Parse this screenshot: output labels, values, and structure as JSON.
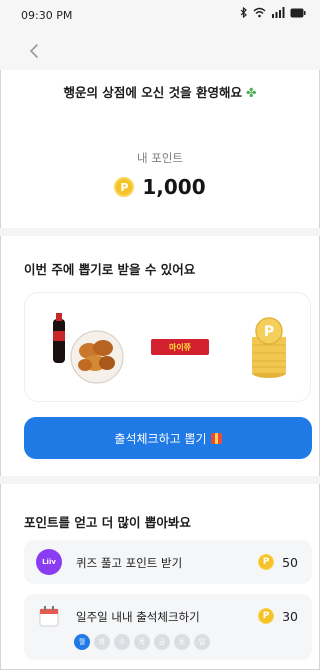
{
  "status_bar": {
    "time": "09:30 PM"
  },
  "header": {
    "back_icon": "chevron-left-icon"
  },
  "welcome": {
    "text": "행운의 상점에 오신 것을 환영해요",
    "icon": "clover-icon"
  },
  "points": {
    "label": "내 포인트",
    "value": "1,000",
    "coin_letter": "P"
  },
  "prizes": {
    "title": "이번 주에 뽑기로 받을 수 있어요",
    "items": [
      "cola-and-chicken",
      "snack-bar",
      "coin-stack"
    ],
    "snack_label": "마이쮸"
  },
  "cta": {
    "label": "출석체크하고 뽑기"
  },
  "missions": {
    "title": "포인트를 얻고 더 많이 뽑아봐요",
    "items": [
      {
        "label": "퀴즈 풀고 포인트 받기",
        "points": "50",
        "icon_text": "Liiv"
      },
      {
        "label": "일주일 내내 출석체크하기",
        "points": "30"
      }
    ],
    "days": [
      "월",
      "화",
      "수",
      "목",
      "금",
      "토",
      "일"
    ]
  },
  "colors": {
    "primary": "#1f7ae6",
    "coin": "#f5c227",
    "liiv": "#8a3cf2"
  }
}
